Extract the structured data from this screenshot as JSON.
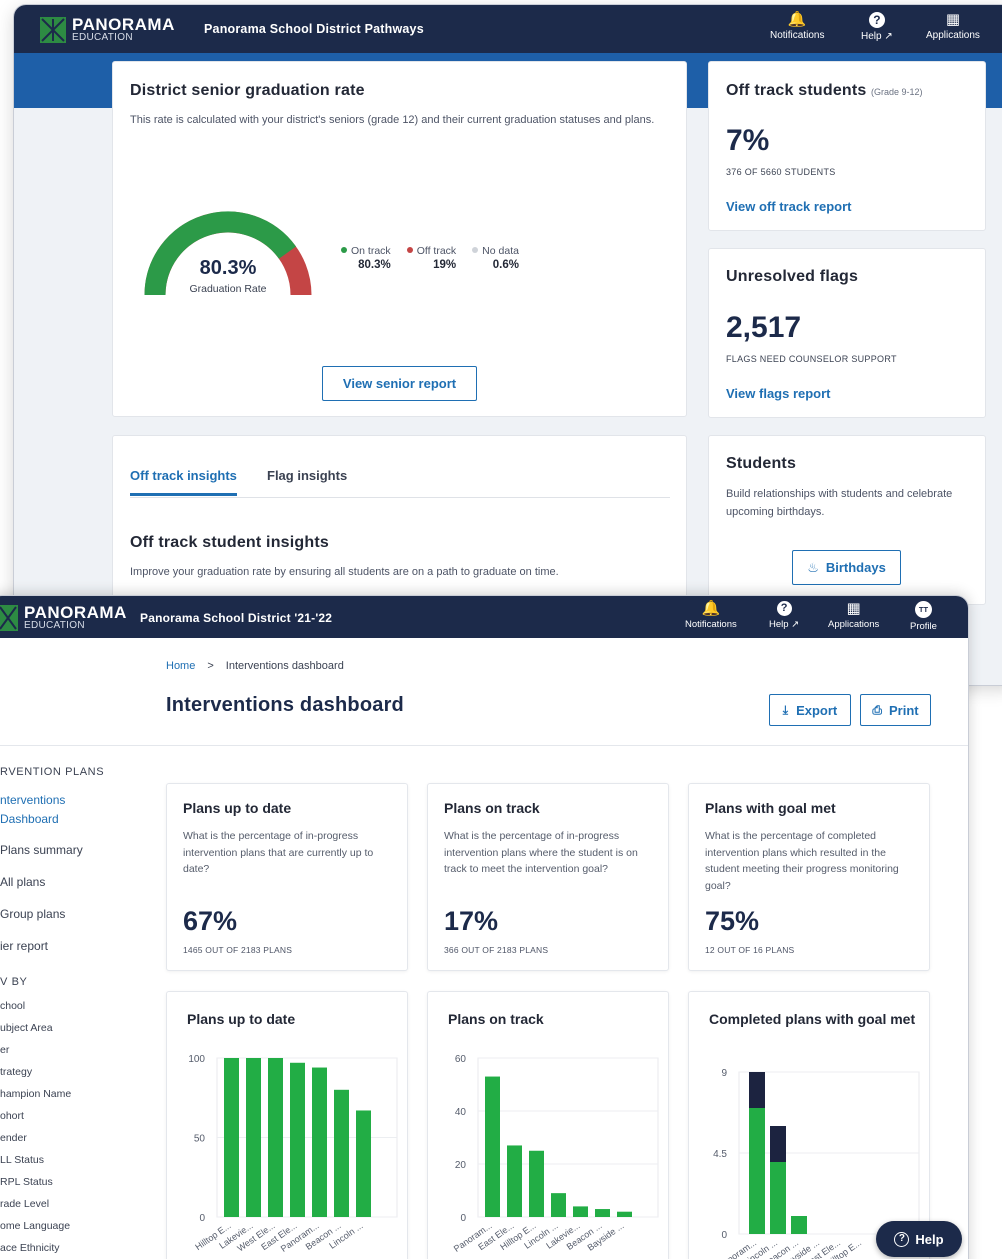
{
  "back": {
    "brand": "PANORAMA",
    "brand_sub": "EDUCATION",
    "district": "Panorama School District Pathways",
    "nav": {
      "notifications": "Notifications",
      "help": "Help",
      "applications": "Applications"
    },
    "grad_card": {
      "title": "District senior graduation rate",
      "desc": "This rate is calculated with your district's seniors (grade 12) and their current graduation statuses and plans.",
      "gauge_value": "80.3%",
      "gauge_label": "Graduation Rate",
      "gauge_fraction": 0.803,
      "legend": [
        {
          "label": "On track",
          "value": "80.3%",
          "color": "#2c9a48"
        },
        {
          "label": "Off track",
          "value": "19%",
          "color": "#c44545"
        },
        {
          "label": "No data",
          "value": "0.6%",
          "color": "#cfd3d9"
        }
      ],
      "button": "View senior report"
    },
    "offtrack_card": {
      "title": "Off track students",
      "title_note": "(Grade 9-12)",
      "value": "7%",
      "caption": "376 OF 5660 STUDENTS",
      "link": "View off track report"
    },
    "flags_card": {
      "title": "Unresolved flags",
      "value": "2,517",
      "caption": "FLAGS NEED COUNSELOR SUPPORT",
      "link": "View flags report"
    },
    "insights_card": {
      "tabs": [
        "Off track insights",
        "Flag insights"
      ],
      "heading": "Off track student insights",
      "desc": "Improve your graduation rate by ensuring all students are on a path to graduate on time."
    },
    "students_card": {
      "title": "Students",
      "desc": "Build relationships with students and celebrate upcoming birthdays.",
      "button": "Birthdays"
    }
  },
  "front": {
    "brand": "PANORAMA",
    "brand_sub": "EDUCATION",
    "district": "Panorama School District '21-'22",
    "nav": {
      "notifications": "Notifications",
      "help": "Help",
      "applications": "Applications",
      "profile": "Profile",
      "avatar": "TT"
    },
    "breadcrumb": {
      "home": "Home",
      "sep": ">",
      "current": "Interventions dashboard"
    },
    "page_title": "Interventions dashboard",
    "export": "Export",
    "print": "Print",
    "sidebar": {
      "section1": "RVENTION PLANS",
      "items": [
        "nterventions",
        "Dashboard",
        "Plans summary",
        "All plans",
        "Group plans",
        "ier report"
      ],
      "section2": "V BY",
      "filters": [
        "chool",
        "ubject Area",
        "er",
        "trategy",
        "hampion Name",
        "ohort",
        "ender",
        "LL Status",
        "RPL Status",
        "rade Level",
        "ome Language",
        "ace Ethnicity"
      ]
    },
    "stat_cards": [
      {
        "title": "Plans up to date",
        "desc": "What is the percentage of in-progress intervention plans that are currently up to date?",
        "value": "67%",
        "caption": "1465 OUT OF 2183 PLANS"
      },
      {
        "title": "Plans on track",
        "desc": "What is the percentage of in-progress intervention plans where the student is on track to meet the intervention goal?",
        "value": "17%",
        "caption": "366 OUT OF 2183 PLANS"
      },
      {
        "title": "Plans with goal met",
        "desc": "What is the percentage of completed intervention plans which resulted in the student meeting their progress monitoring goal?",
        "value": "75%",
        "caption": "12 OUT OF 16 PLANS"
      }
    ],
    "help_button": "Help"
  },
  "chart_data": [
    {
      "type": "bar",
      "title": "Plans up to date",
      "categories": [
        "Hilltop E...",
        "Lakevie...",
        "West Ele...",
        "East Ele...",
        "Panoram...",
        "Beacon ...",
        "Lincoln ..."
      ],
      "values": [
        100,
        100,
        100,
        97,
        94,
        80,
        67
      ],
      "ylim": [
        0,
        100
      ],
      "yticks": [
        "100",
        "50",
        "0"
      ],
      "color": "#22ad45"
    },
    {
      "type": "bar",
      "title": "Plans on track",
      "categories": [
        "Panoram...",
        "East Ele...",
        "Hilltop E...",
        "Lincoln ...",
        "Lakevie...",
        "Beacon ...",
        "Bayside ..."
      ],
      "values": [
        53,
        27,
        25,
        9,
        4,
        3,
        2
      ],
      "ylim": [
        0,
        60
      ],
      "yticks": [
        "60",
        "40",
        "20",
        "0"
      ],
      "color": "#22ad45"
    },
    {
      "type": "bar",
      "stacked": true,
      "title": "Completed plans with goal met",
      "categories": [
        "Panoram...",
        "Lincoln ...",
        "Beacon ...",
        "Bayside ...",
        "East Ele...",
        "Hilltop E..."
      ],
      "series": [
        {
          "values": [
            7,
            4,
            1,
            0,
            0,
            0
          ],
          "color": "#22ad45"
        },
        {
          "values": [
            2,
            2,
            0,
            0,
            0,
            0
          ],
          "color": "#1c2340"
        }
      ],
      "ylim": [
        0,
        9
      ],
      "yticks": [
        "9",
        "4.5",
        "0"
      ]
    }
  ]
}
